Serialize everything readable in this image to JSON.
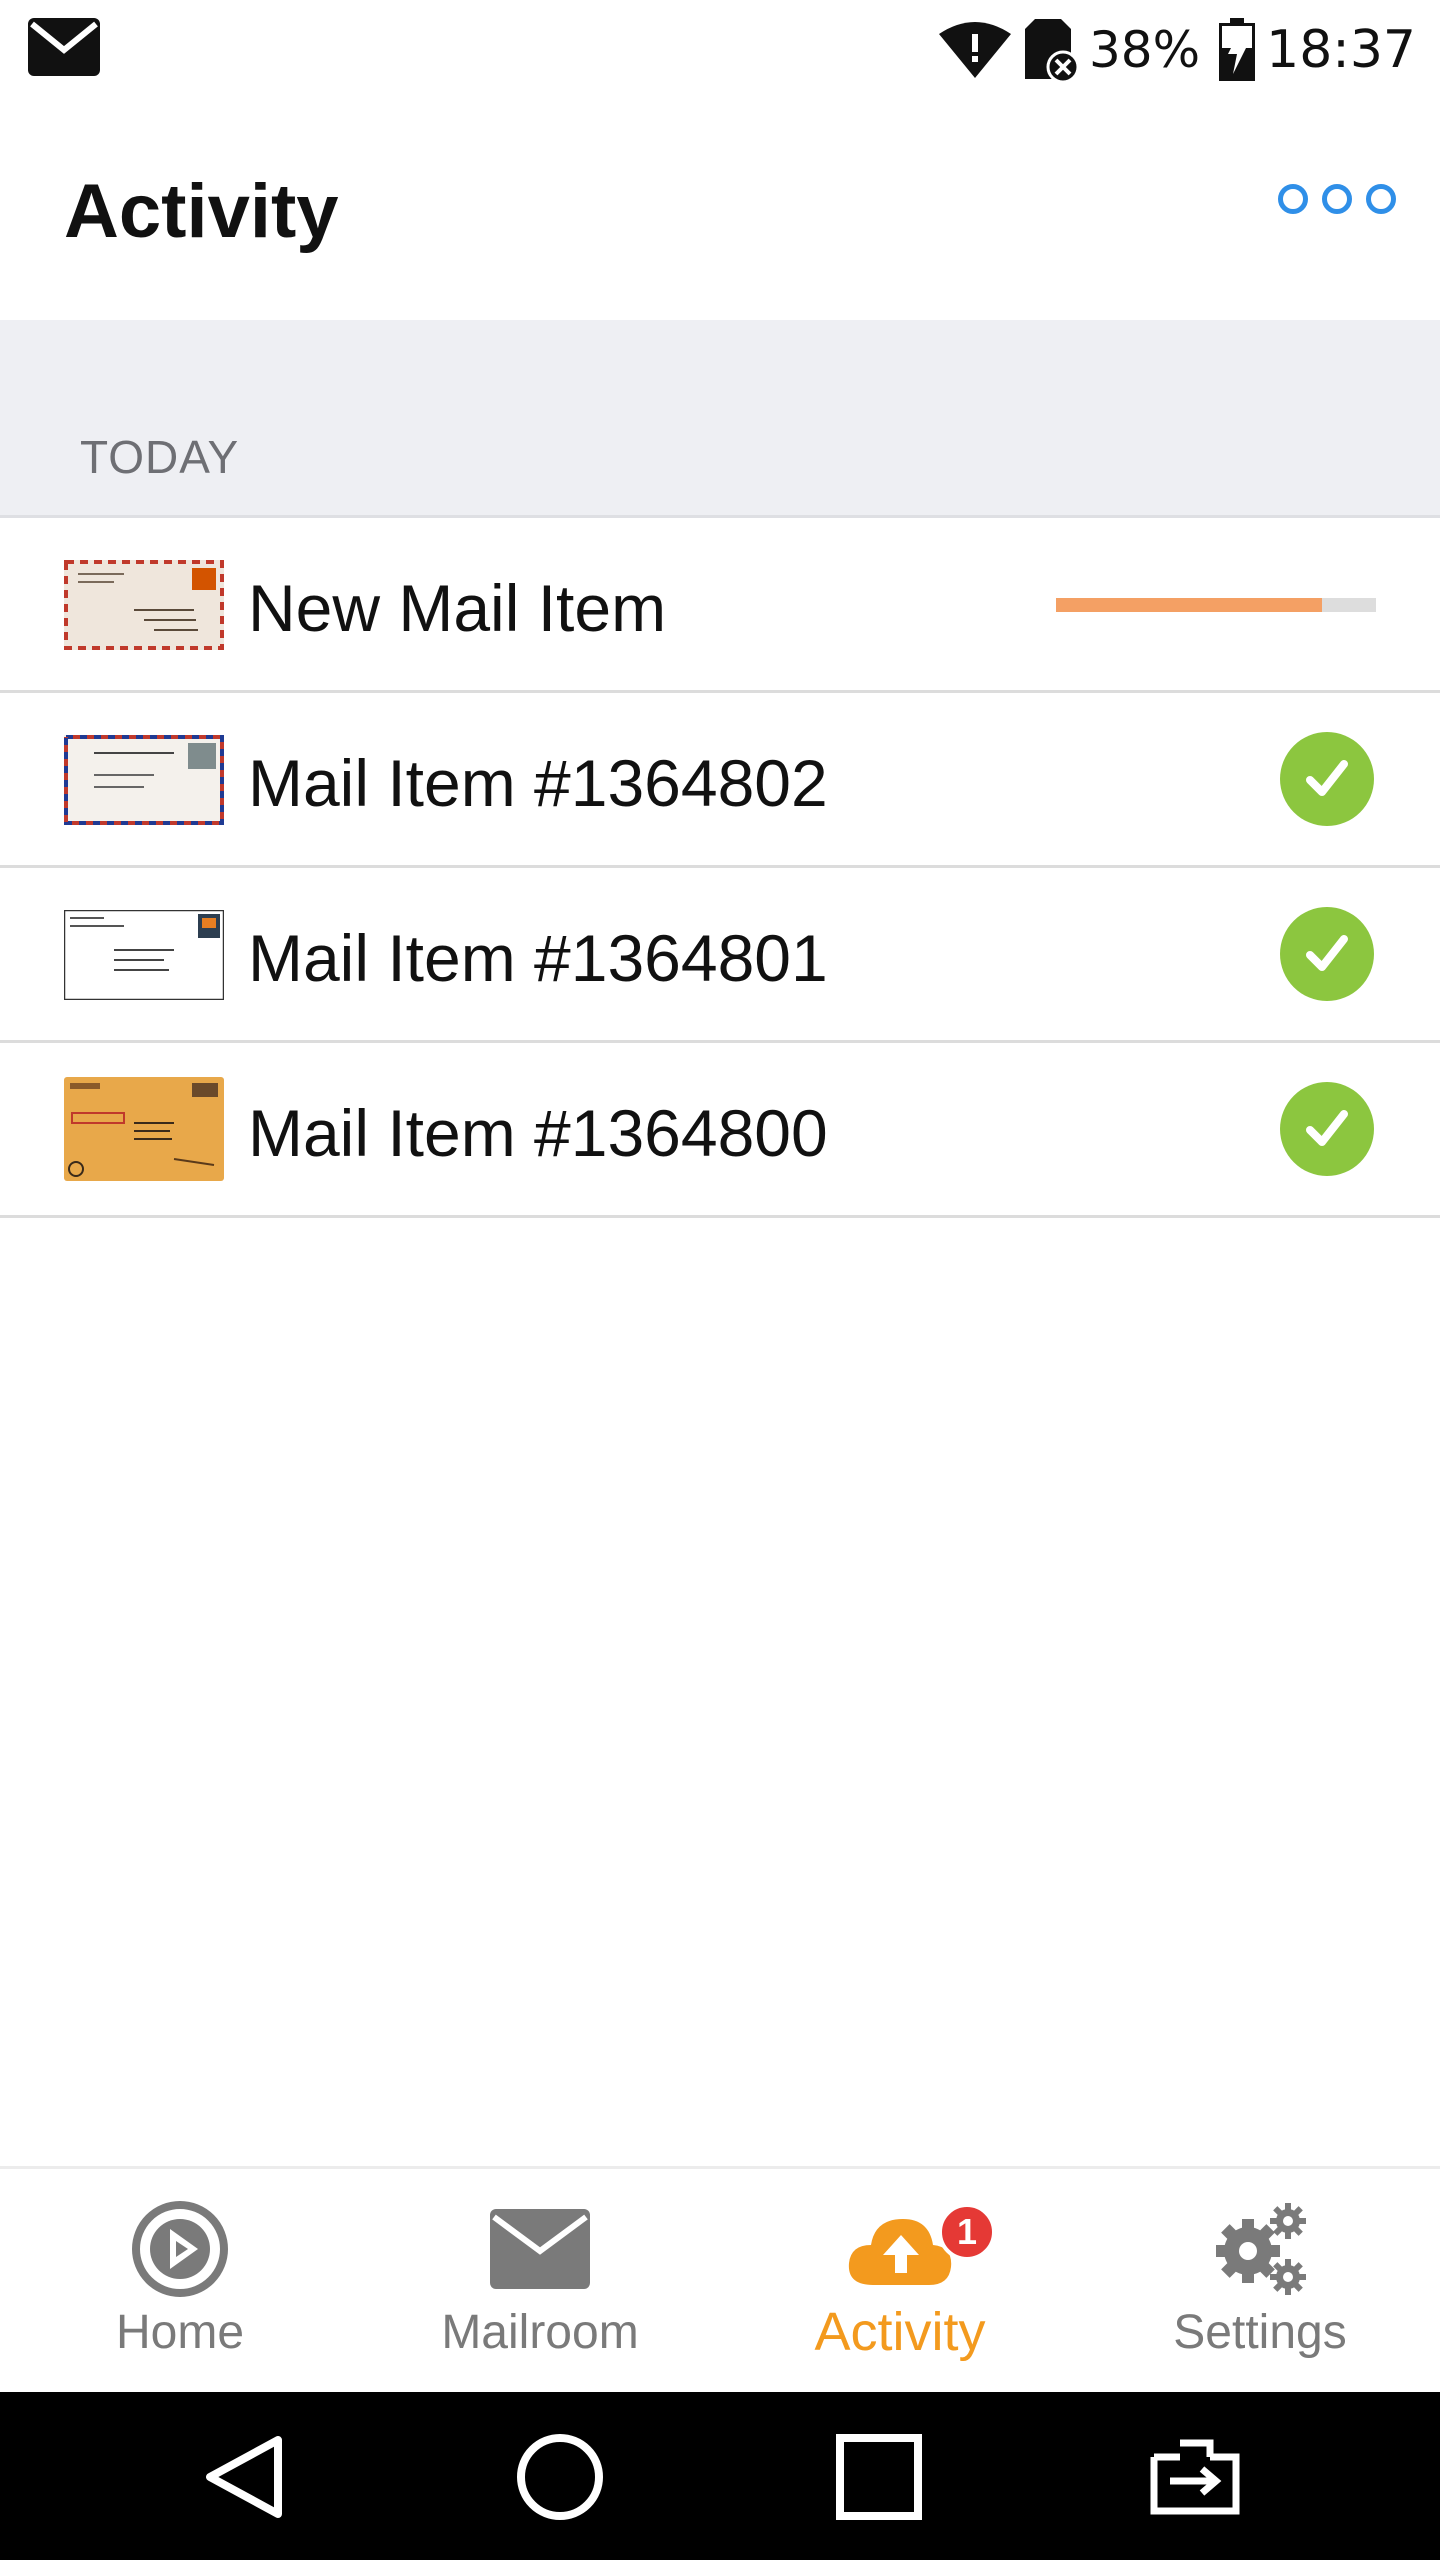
{
  "status_bar": {
    "battery_percent": "38%",
    "time": "18:37",
    "icons": [
      "mail-notification-icon",
      "wifi-icon",
      "sim-error-icon",
      "battery-charging-icon"
    ]
  },
  "app_bar": {
    "title": "Activity",
    "more_icon": "more-options-icon"
  },
  "section": {
    "label": "TODAY"
  },
  "items": [
    {
      "title": "New Mail Item",
      "status": "uploading",
      "progress": 0.83
    },
    {
      "title": "Mail Item #1364802",
      "status": "done"
    },
    {
      "title": "Mail Item #1364801",
      "status": "done"
    },
    {
      "title": "Mail Item #1364800",
      "status": "done"
    }
  ],
  "bottom_nav": {
    "home": "Home",
    "mailroom": "Mailroom",
    "activity": "Activity",
    "activity_badge": "1",
    "settings": "Settings",
    "active": "activity"
  },
  "colors": {
    "accent_orange": "#f39a1e",
    "progress_fill": "#f4a064",
    "success_green": "#8cc63f",
    "link_blue": "#2f8fe8",
    "badge_red": "#e53935"
  }
}
